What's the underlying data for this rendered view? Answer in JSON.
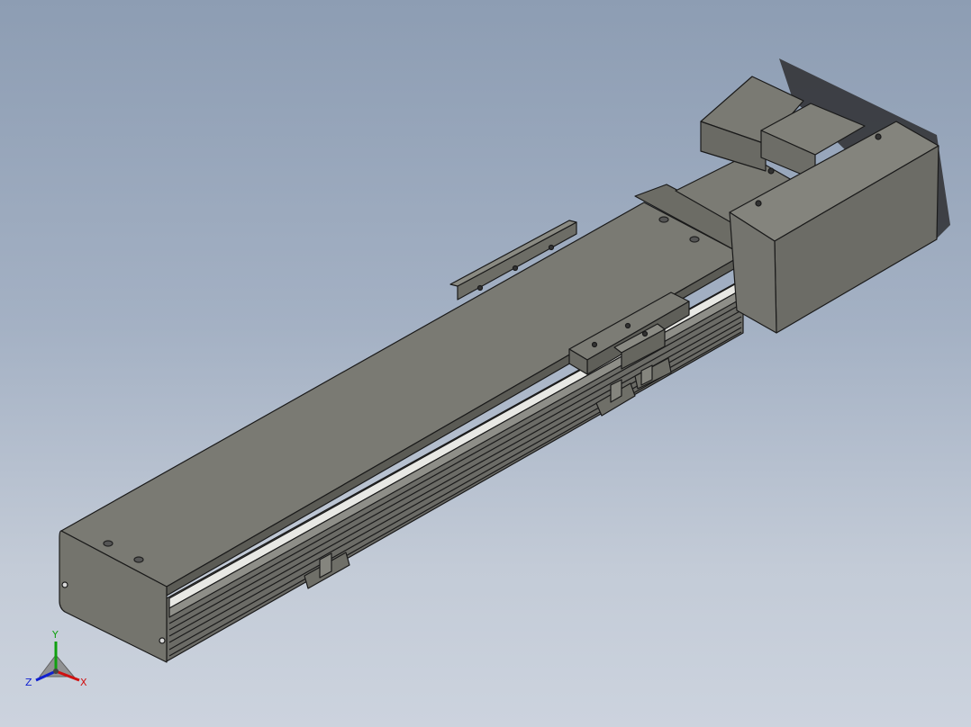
{
  "viewport": {
    "background_top": "#8d9db3",
    "background_bottom": "#ccd3de",
    "model_face_color": "#76766f",
    "model_edge_color": "#1a1a1a"
  },
  "triad": {
    "x_label": "X",
    "y_label": "Y",
    "z_label": "Z",
    "x_color": "#d01010",
    "y_color": "#10a010",
    "z_color": "#1020d0"
  }
}
